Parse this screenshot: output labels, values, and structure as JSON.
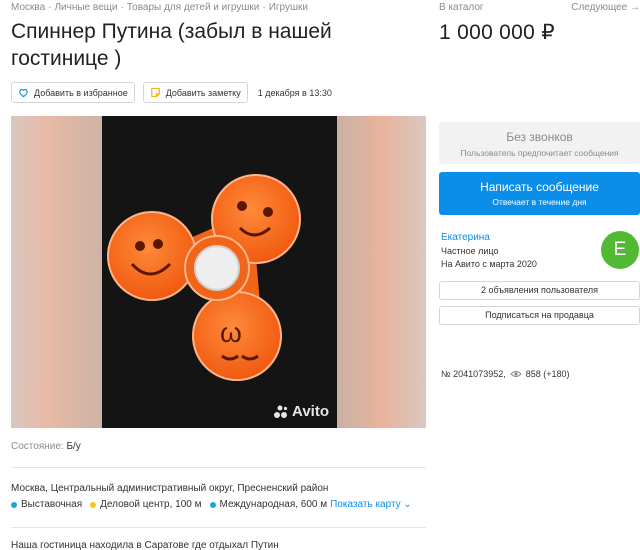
{
  "breadcrumb": [
    "Москва",
    "Личные вещи",
    "Товары для детей и игрушки",
    "Игрушки"
  ],
  "title": "Спиннер Путина (забыл в нашей гостинице )",
  "actions": {
    "favorite_label": "Добавить в избранное",
    "note_label": "Добавить заметку",
    "date": "1 декабря в 13:30"
  },
  "gallery": {
    "watermark": "Avito"
  },
  "props": {
    "condition_label": "Состояние:",
    "condition_value": "Б/у"
  },
  "address": "Москва, Центральный административный округ, Пресненский район",
  "metro": [
    {
      "name": "Выставочная",
      "color": "#1aa7d6"
    },
    {
      "name": "Деловой центр, 100 м",
      "color": "#f5c518"
    },
    {
      "name": "Международная, 600 м",
      "color": "#1aa7d6"
    }
  ],
  "map_link": "Показать карту",
  "description": "Наша гостиница находила в Саратове где отдыхал Путин",
  "sidebar": {
    "catalog_link": "В каталог",
    "next_link": "Следующее →",
    "price": "1 000 000 ₽",
    "no_calls_title": "Без звонков",
    "no_calls_sub": "Пользователь предпочитает сообщения",
    "message_title": "Написать сообщение",
    "message_sub": "Отвечает в течение дня",
    "seller_name": "Екатерина",
    "seller_type": "Частное лицо",
    "seller_since": "На Авито с марта 2020",
    "avatar_letter": "E",
    "ads_button": "2 объявления пользователя",
    "subscribe_button": "Подписаться на продавца",
    "ad_number": "№ 2041073952,",
    "views": "858 (+180)"
  },
  "colors": {
    "accent": "#0a8ee8",
    "avatar": "#52b934",
    "spinner": "#ff6a1a"
  }
}
